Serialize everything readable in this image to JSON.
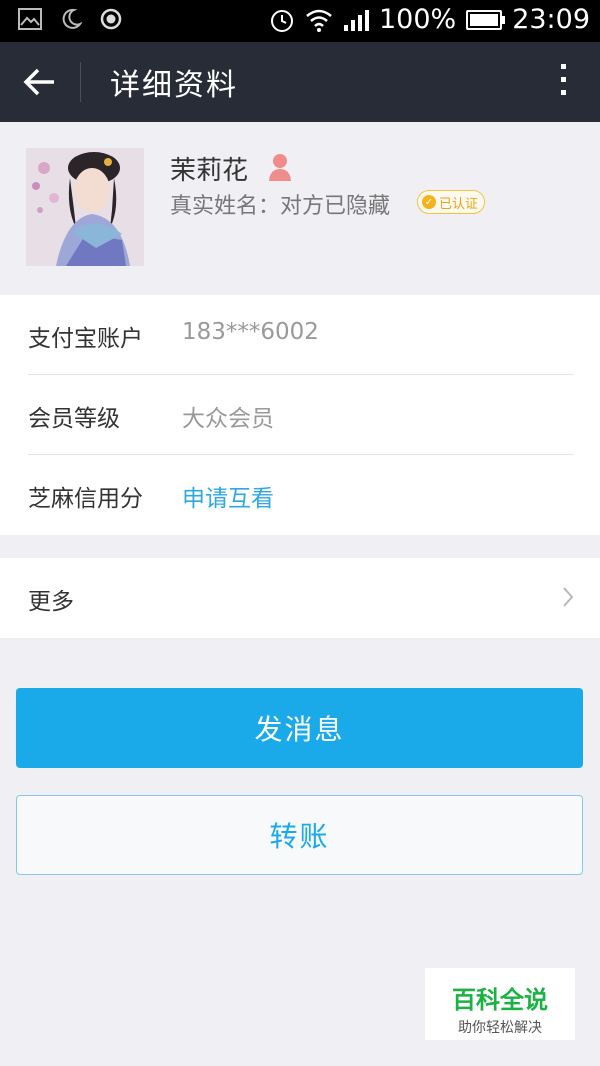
{
  "status_bar": {
    "battery_percent": "100%",
    "time": "23:09"
  },
  "header": {
    "title": "详细资料"
  },
  "profile": {
    "nickname": "茉莉花",
    "real_name_text": "真实姓名：对方已隐藏",
    "verified_badge": "已认证"
  },
  "info": {
    "rows": [
      {
        "label": "支付宝账户",
        "value": "183***6002"
      },
      {
        "label": "会员等级",
        "value": "大众会员"
      },
      {
        "label": "芝麻信用分",
        "value": "申请互看"
      }
    ]
  },
  "more": {
    "label": "更多"
  },
  "actions": {
    "send_message": "发消息",
    "transfer": "转账"
  },
  "watermark": {
    "title": "百科全说",
    "subtitle": "助你轻松解决"
  },
  "colors": {
    "header_bg": "#282c36",
    "primary": "#1aaaea",
    "link": "#2da8e0",
    "badge": "#f5b21c",
    "watermark_green": "#1bb244"
  }
}
